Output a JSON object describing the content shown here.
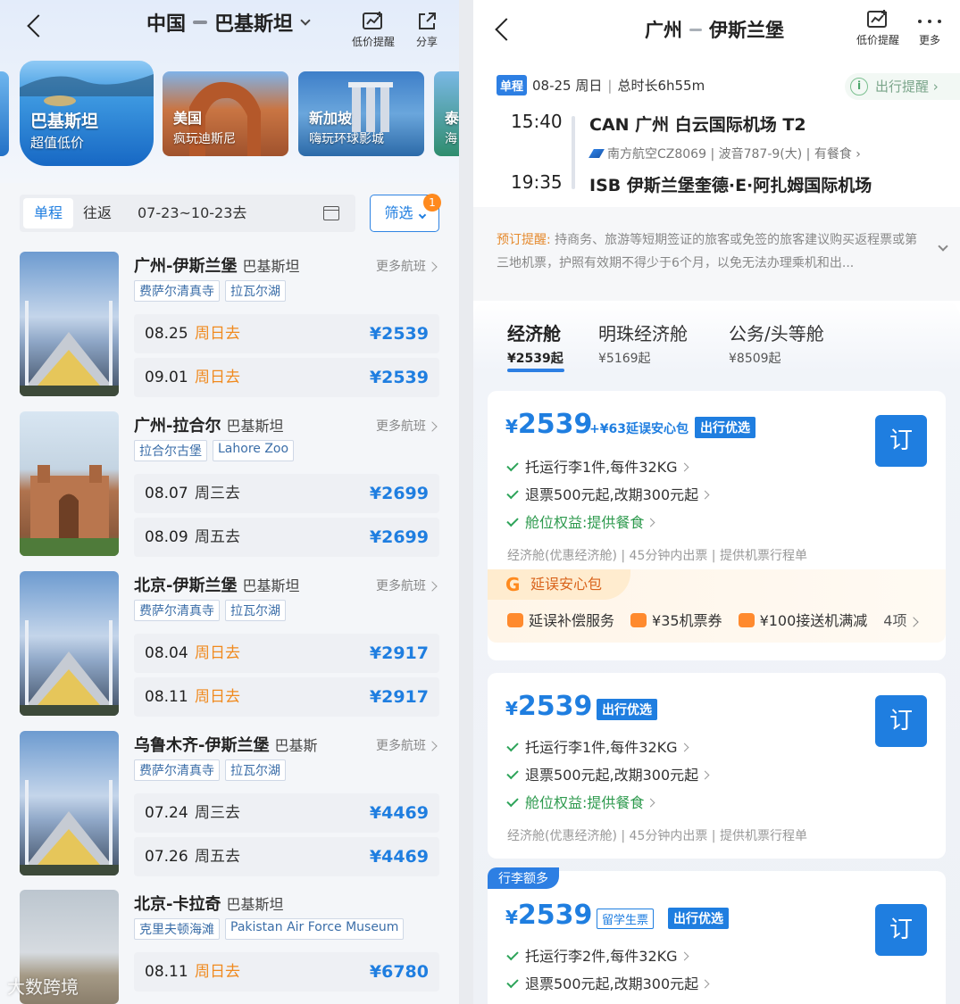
{
  "left": {
    "header": {
      "origin": "中国",
      "destination": "巴基斯坦",
      "price_alert_label": "低价提醒",
      "share_label": "分享"
    },
    "promos": [
      {
        "title": "巴基斯坦",
        "subtitle": "超值低价"
      },
      {
        "title": "美国",
        "subtitle": "疯玩迪斯尼"
      },
      {
        "title": "新加坡",
        "subtitle": "嗨玩环球影城"
      },
      {
        "title": "泰",
        "subtitle": "海"
      }
    ],
    "filter": {
      "oneway": "单程",
      "roundtrip": "往返",
      "date_range": "07-23~10-23去",
      "filter_label": "筛选",
      "badge_count": "1"
    },
    "more_label": "更多航班",
    "routes": [
      {
        "name": "广州-伊斯兰堡",
        "country": "巴基斯坦",
        "tags": [
          "费萨尔清真寺",
          "拉瓦尔湖"
        ],
        "flights": [
          {
            "date": "08.25",
            "weekday": "周日去",
            "price": "¥2539"
          },
          {
            "date": "09.01",
            "weekday": "周日去",
            "price": "¥2539"
          }
        ]
      },
      {
        "name": "广州-拉合尔",
        "country": "巴基斯坦",
        "tags": [
          "拉合尔古堡",
          "Lahore Zoo"
        ],
        "flights": [
          {
            "date": "08.07",
            "weekday": "周三去",
            "price": "¥2699"
          },
          {
            "date": "08.09",
            "weekday": "周五去",
            "price": "¥2699"
          }
        ]
      },
      {
        "name": "北京-伊斯兰堡",
        "country": "巴基斯坦",
        "tags": [
          "费萨尔清真寺",
          "拉瓦尔湖"
        ],
        "flights": [
          {
            "date": "08.04",
            "weekday": "周日去",
            "price": "¥2917"
          },
          {
            "date": "08.11",
            "weekday": "周日去",
            "price": "¥2917"
          }
        ]
      },
      {
        "name": "乌鲁木齐-伊斯兰堡",
        "country": "巴基斯",
        "tags": [
          "费萨尔清真寺",
          "拉瓦尔湖"
        ],
        "flights": [
          {
            "date": "07.24",
            "weekday": "周三去",
            "price": "¥4469"
          },
          {
            "date": "07.26",
            "weekday": "周五去",
            "price": "¥4469"
          }
        ]
      },
      {
        "name": "北京-卡拉奇",
        "country": "巴基斯坦",
        "tags": [
          "克里夫顿海滩",
          "Pakistan Air Force Museum"
        ],
        "flights": [
          {
            "date": "08.11",
            "weekday": "周日去",
            "price": "¥6780"
          }
        ]
      }
    ],
    "watermark": "大数跨境"
  },
  "right": {
    "header": {
      "origin": "广州",
      "destination": "伊斯兰堡",
      "price_alert_label": "低价提醒",
      "more_label": "更多"
    },
    "flight": {
      "badge": "单程",
      "date": "08-25 周日",
      "duration": "总时长6h55m",
      "reminder": "出行提醒",
      "dep_time": "15:40",
      "dep_airport": "CAN  广州 白云国际机场 T2",
      "airline_info": "南方航空CZ8069 | 波音787-9(大) | 有餐食",
      "arr_time": "19:35",
      "arr_airport": "ISB  伊斯兰堡奎德·E·阿扎姆国际机场"
    },
    "notice": {
      "label": "预订提醒:",
      "text": " 持商务、旅游等短期签证的旅客或免签的旅客建议购买返程票或第三地机票，护照有效期不得少于6个月，以免无法办理乘机和出..."
    },
    "cabins": [
      {
        "name": "经济舱",
        "price": "¥2539起"
      },
      {
        "name": "明珠经济舱",
        "price": "¥5169起"
      },
      {
        "name": "公务/头等舱",
        "price": "¥8509起"
      }
    ],
    "book_label": "订",
    "cards": [
      {
        "price": "2539",
        "extra": "+¥63延误安心包",
        "pill": "出行优选",
        "features": [
          "托运行李1件,每件32KG",
          "退票500元起,改期300元起",
          "舱位权益:提供餐食"
        ],
        "meta": "经济舱(优惠经济舱) | 45分钟内出票 | 提供机票行程单",
        "delay": {
          "title": "延误安心包",
          "items": [
            "延误补偿服务",
            "¥35机票券",
            "¥100接送机满减"
          ],
          "more": "4项"
        }
      },
      {
        "price": "2539",
        "pill": "出行优选",
        "features": [
          "托运行李1件,每件32KG",
          "退票500元起,改期300元起",
          "舱位权益:提供餐食"
        ],
        "meta": "经济舱(优惠经济舱) | 45分钟内出票 | 提供机票行程单"
      },
      {
        "corner": "行李额多",
        "price": "2539",
        "tag": "留学生票",
        "pill": "出行优选",
        "features": [
          "托运行李2件,每件32KG",
          "退票500元起,改期300元起"
        ]
      }
    ]
  }
}
